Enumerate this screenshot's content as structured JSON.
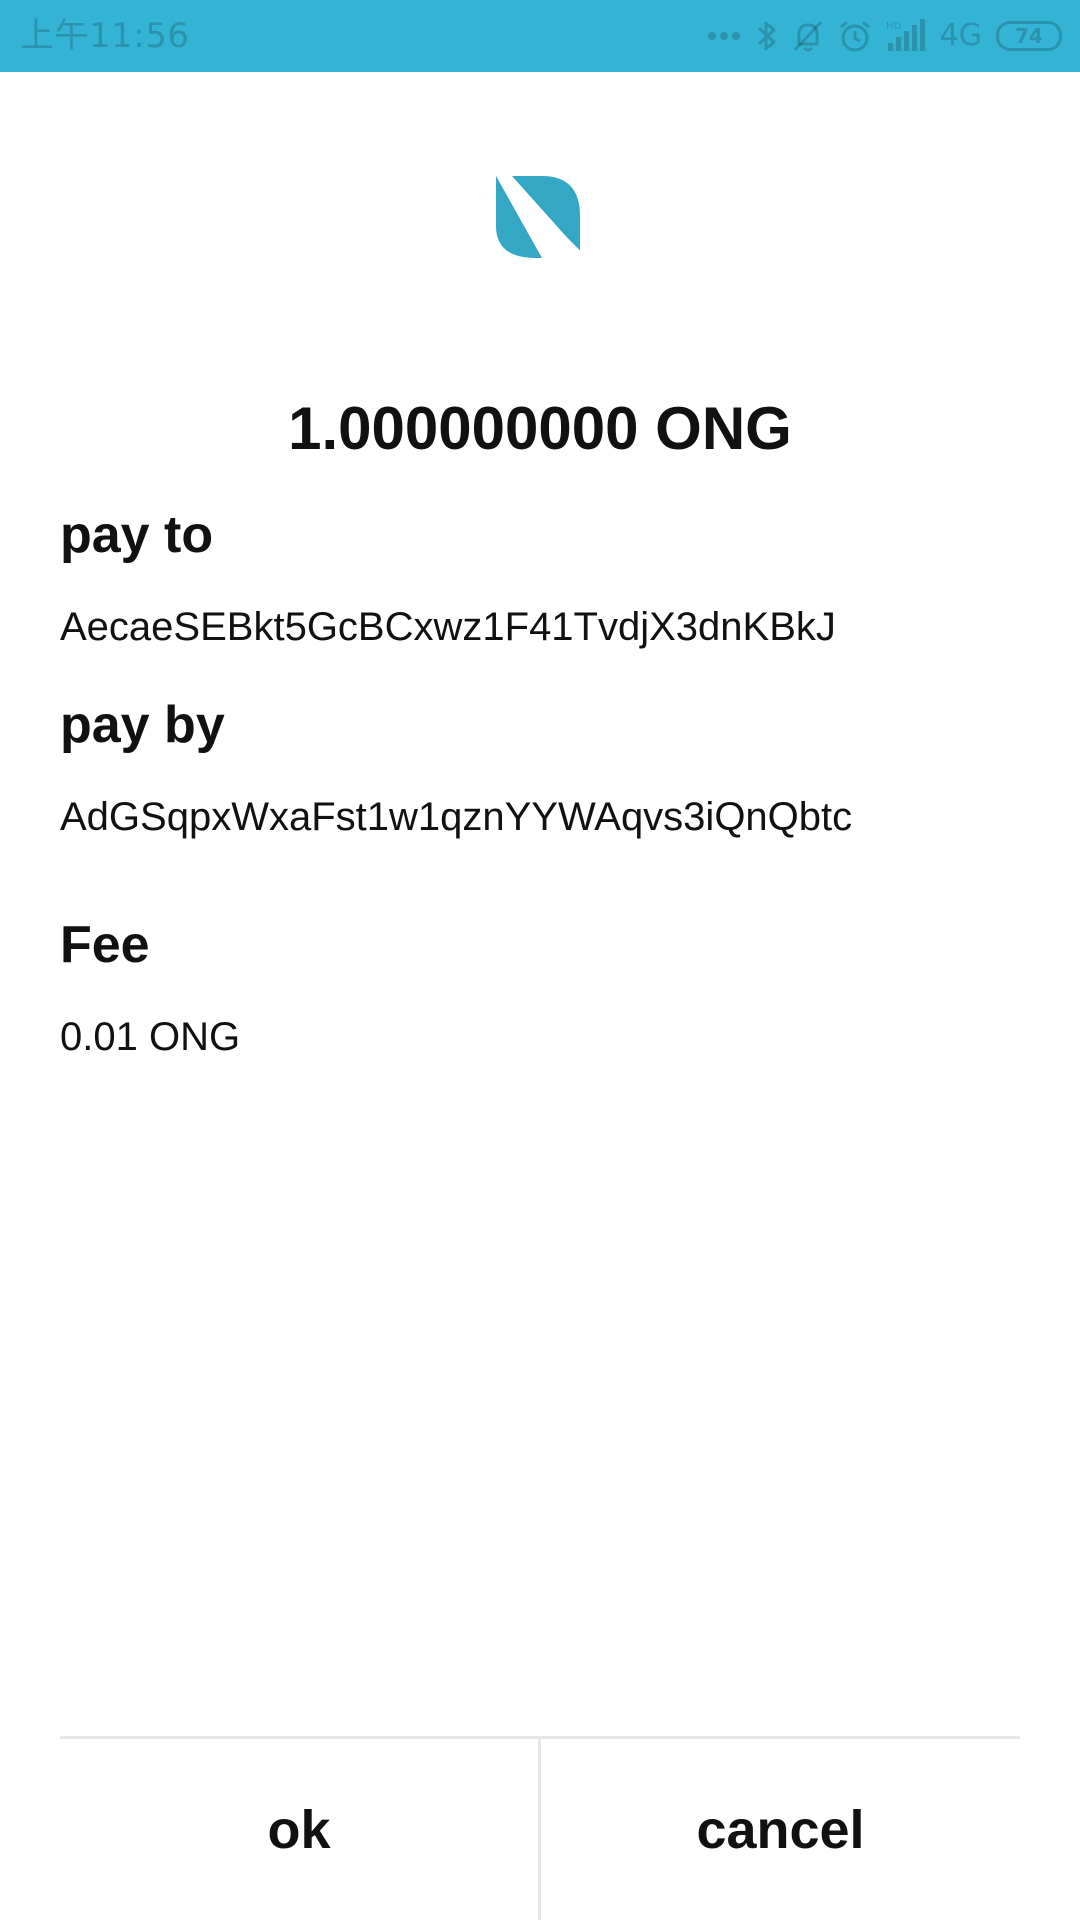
{
  "status_bar": {
    "time": "上午11:56",
    "network": "4G",
    "battery": "74",
    "color": "#34b4d4",
    "icons": [
      "more-dots-icon",
      "bluetooth-icon",
      "mute-bell-icon",
      "alarm-icon",
      "signal-hd-icon",
      "battery-icon"
    ]
  },
  "logo": {
    "icon": "ontology-logo",
    "color": "#34a7c4"
  },
  "transfer": {
    "amount": "1.000000000 ONG",
    "pay_to_label": "pay to",
    "pay_to_address": "AecaeSEBkt5GcBCxwz1F41TvdjX3dnKBkJ",
    "pay_by_label": "pay by",
    "pay_by_address": "AdGSqpxWxaFst1w1qznYYWAqvs3iQnQbtc",
    "fee_label": "Fee",
    "fee_value": "0.01 ONG"
  },
  "actions": {
    "ok_label": "ok",
    "cancel_label": "cancel"
  }
}
